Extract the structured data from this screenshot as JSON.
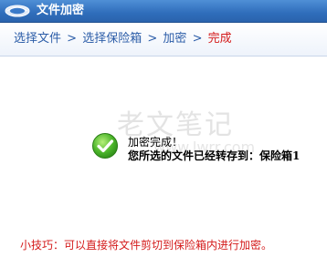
{
  "window": {
    "title": "文件加密",
    "logo_icon": "app-logo-icon"
  },
  "steps": {
    "items": [
      {
        "label": "选择文件",
        "state": "done"
      },
      {
        "label": "选择保险箱",
        "state": "done"
      },
      {
        "label": "加密",
        "state": "done"
      },
      {
        "label": "完成",
        "state": "current"
      }
    ],
    "separator": ">",
    "current_color": "#d41b1b",
    "link_color": "#2c5da8"
  },
  "result": {
    "icon": "success-check-icon",
    "title": "加密完成！",
    "detail": "您所选的文件已经转存到：保险箱1"
  },
  "watermark": {
    "text": "老文笔记",
    "url": "www.lwrr.com"
  },
  "tip": {
    "text": "小技巧：可以直接将文件剪切到保险箱内进行加密。",
    "color": "#d41b1b"
  }
}
